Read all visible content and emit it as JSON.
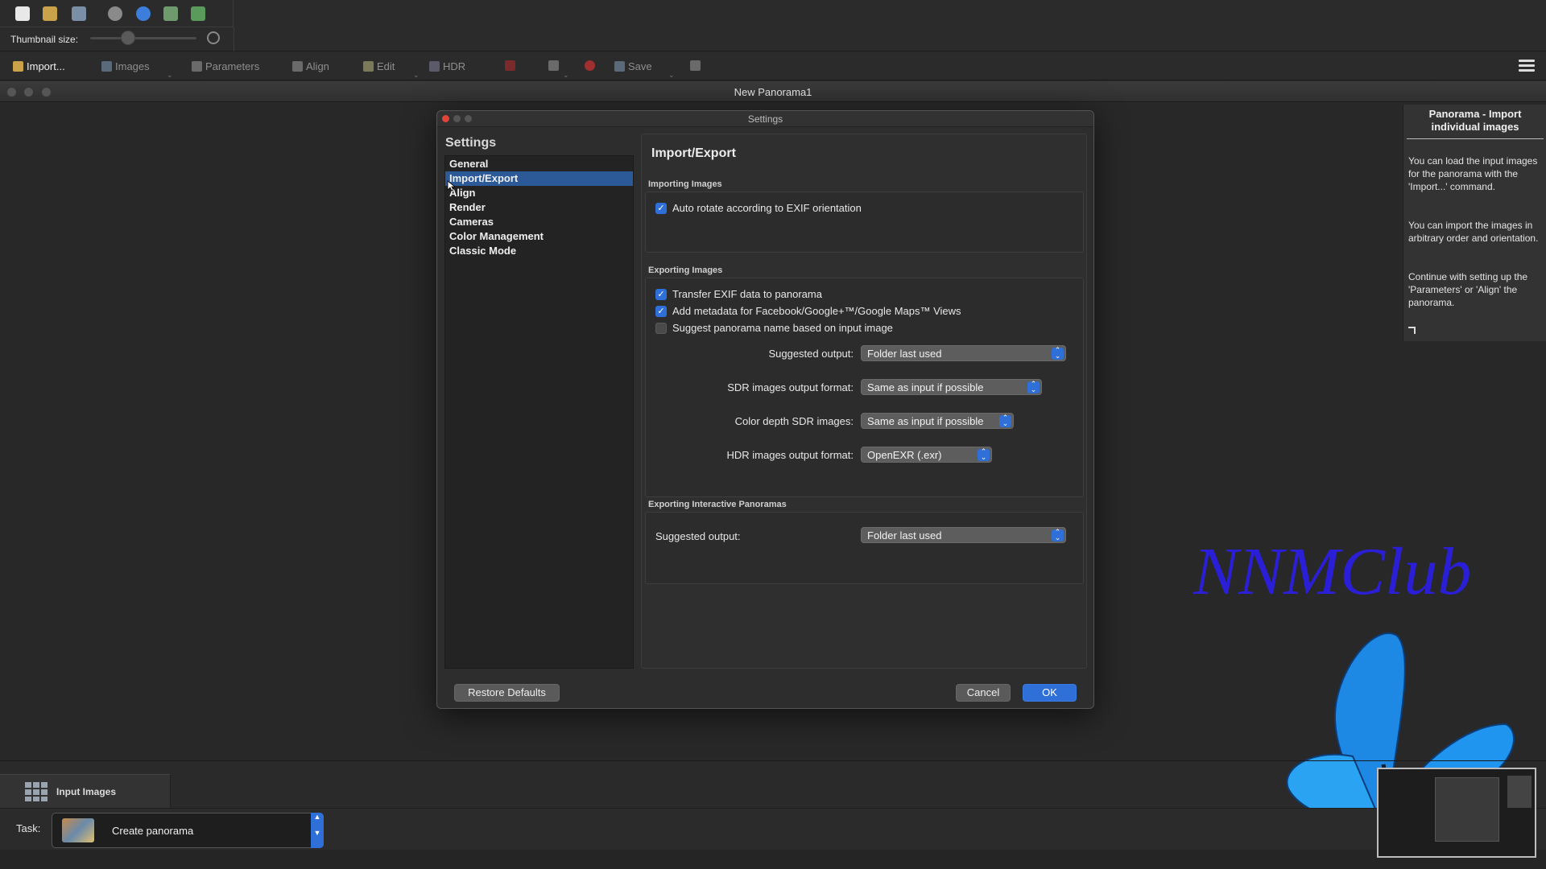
{
  "top_toolbar": {
    "thumbnail_label": "Thumbnail size:"
  },
  "main_toolbar": {
    "import": "Import...",
    "images": "Images",
    "parameters": "Parameters",
    "align": "Align",
    "edit": "Edit",
    "hdr": "HDR",
    "save": "Save"
  },
  "window": {
    "title": "New Panorama1"
  },
  "dialog": {
    "title": "Settings",
    "sidebar_heading": "Settings",
    "sidebar_items": [
      "General",
      "Import/Export",
      "Align",
      "Render",
      "Cameras",
      "Color Management",
      "Classic Mode"
    ],
    "selected_item": "Import/Export",
    "content_title": "Import/Export",
    "importing": {
      "label": "Importing Images",
      "auto_rotate": "Auto rotate according to EXIF orientation",
      "auto_rotate_checked": true
    },
    "exporting": {
      "label": "Exporting Images",
      "transfer_exif": "Transfer EXIF data to panorama",
      "transfer_exif_checked": true,
      "add_metadata": "Add metadata for Facebook/Google+™/Google Maps™ Views",
      "add_metadata_checked": true,
      "suggest_name": "Suggest panorama name based on input image",
      "suggest_name_checked": false,
      "suggested_output_label": "Suggested output:",
      "suggested_output_value": "Folder last used",
      "sdr_format_label": "SDR images output format:",
      "sdr_format_value": "Same as input if possible",
      "color_depth_label": "Color depth SDR images:",
      "color_depth_value": "Same as input if possible",
      "hdr_format_label": "HDR images output format:",
      "hdr_format_value": "OpenEXR (.exr)"
    },
    "interactive": {
      "label": "Exporting Interactive Panoramas",
      "suggested_output_label": "Suggested output:",
      "suggested_output_value": "Folder last used"
    },
    "restore_defaults": "Restore Defaults",
    "cancel": "Cancel",
    "ok": "OK"
  },
  "help_panel": {
    "title": "Panorama - Import individual images",
    "p1": "You can load the input images for the panorama with the 'Import...' command.",
    "p2": "You can import the images in arbitrary order and orientation.",
    "p3": "Continue with setting up the 'Parameters' or 'Align' the panorama."
  },
  "watermark": {
    "text": "NNMClub"
  },
  "bottom": {
    "input_images": "Input Images",
    "task_label": "Task:",
    "task_value": "Create panorama"
  },
  "colors": {
    "accent": "#2f6fd8",
    "selection": "#2c5a99",
    "watermark": "#2a1fd6",
    "butterfly": "#1e90ff"
  },
  "icons": [
    "new-file-icon",
    "open-folder-icon",
    "save-icon",
    "info-icon",
    "help-icon",
    "export-icon",
    "stitch-icon",
    "hamburger-menu-icon",
    "butterfly-image",
    "zoom-icon"
  ]
}
